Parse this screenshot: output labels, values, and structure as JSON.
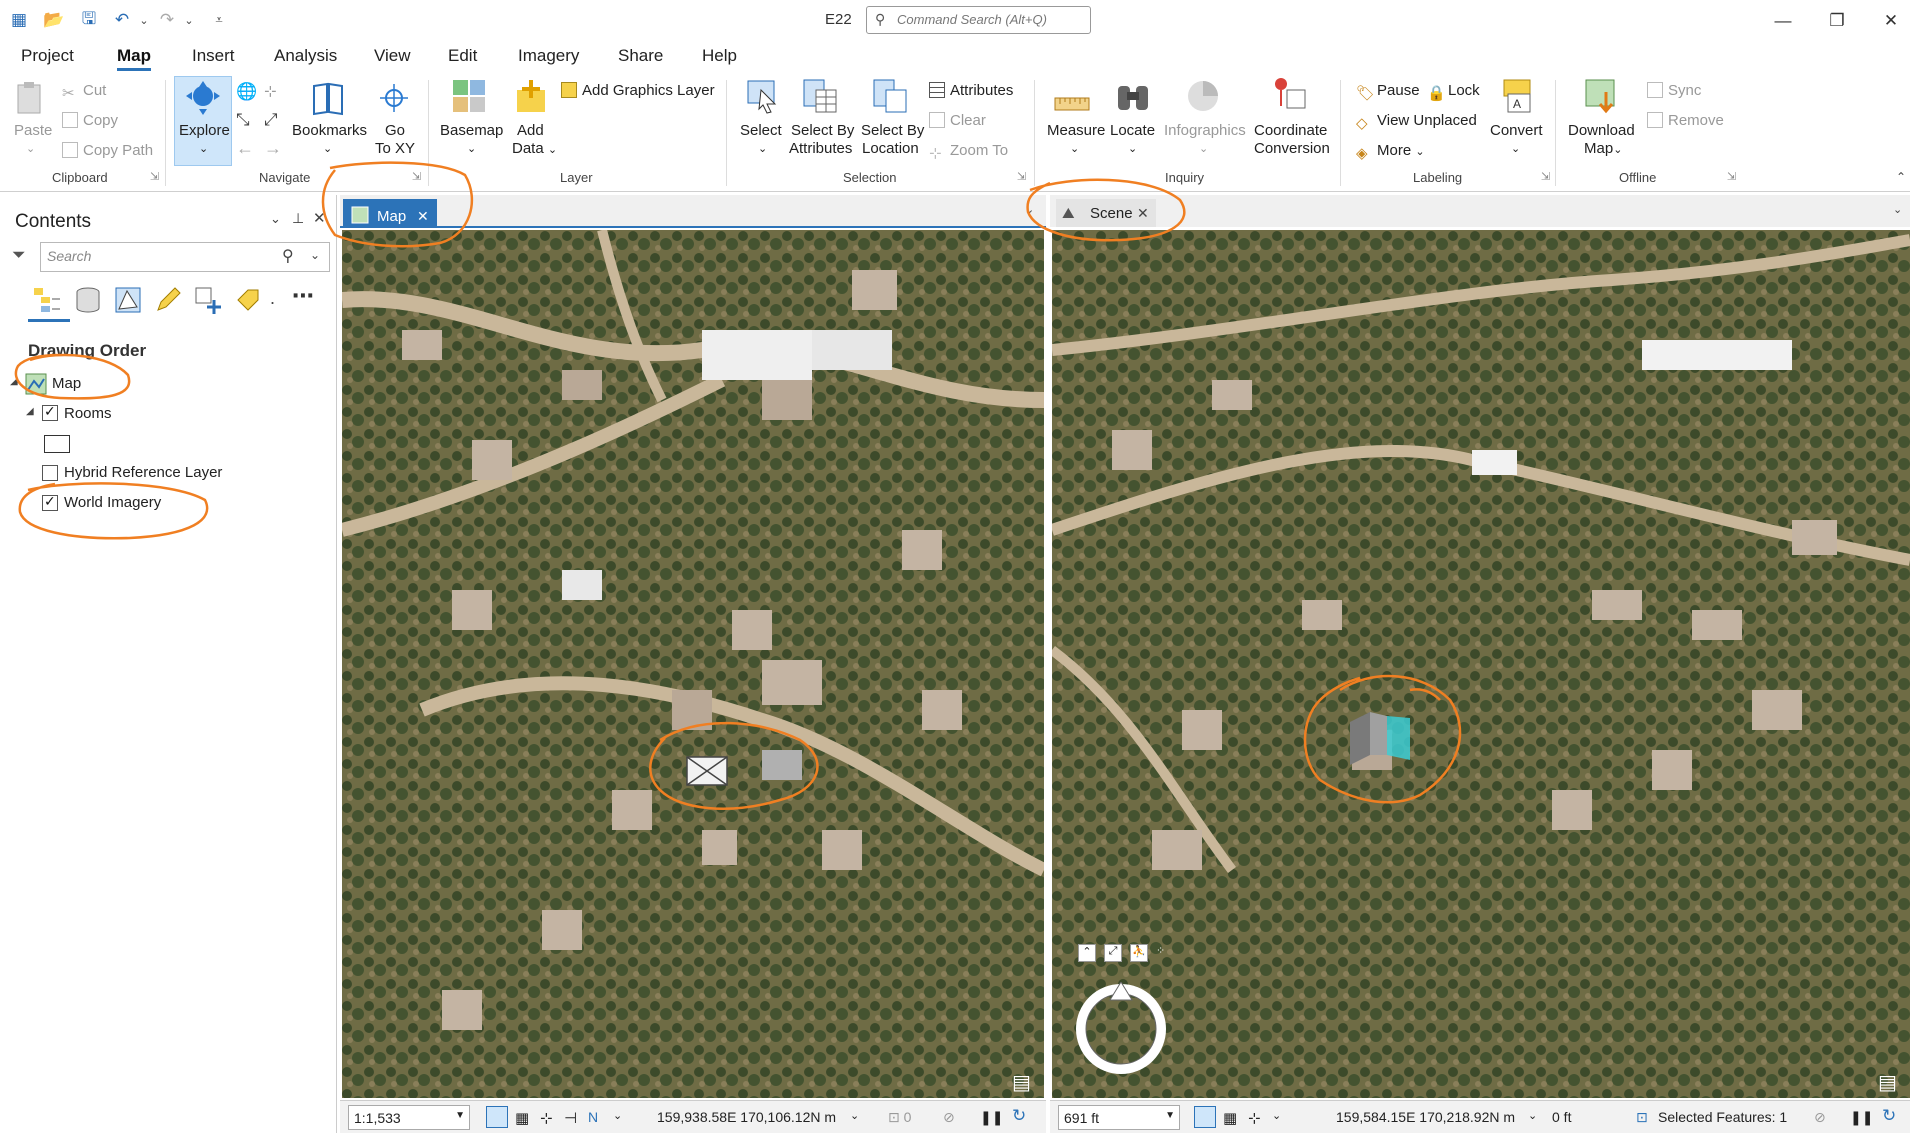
{
  "title_bar": {
    "document_title": "E22",
    "command_search_placeholder": "Command Search (Alt+Q)"
  },
  "menu": [
    "Project",
    "Map",
    "Insert",
    "Analysis",
    "View",
    "Edit",
    "Imagery",
    "Share",
    "Help"
  ],
  "menu_active": "Map",
  "ribbon": {
    "clipboard": {
      "paste": "Paste",
      "cut": "Cut",
      "copy": "Copy",
      "copy_path": "Copy Path",
      "group": "Clipboard"
    },
    "navigate": {
      "explore": "Explore",
      "bookmarks": "Bookmarks",
      "go_to_xy_1": "Go",
      "go_to_xy_2": "To XY",
      "group": "Navigate"
    },
    "layer": {
      "basemap": "Basemap",
      "add_data_1": "Add",
      "add_data_2": "Data",
      "add_graphics_layer": "Add Graphics Layer",
      "group": "Layer"
    },
    "selection": {
      "select": "Select",
      "sba_1": "Select By",
      "sba_2": "Attributes",
      "sbl_1": "Select By",
      "sbl_2": "Location",
      "attributes": "Attributes",
      "clear": "Clear",
      "zoom_to": "Zoom To",
      "group": "Selection"
    },
    "inquiry": {
      "measure": "Measure",
      "locate": "Locate",
      "infographics": "Infographics",
      "coord_1": "Coordinate",
      "coord_2": "Conversion",
      "group": "Inquiry"
    },
    "labeling": {
      "pause": "Pause",
      "lock": "Lock",
      "view_unplaced": "View Unplaced",
      "more": "More",
      "convert": "Convert",
      "group": "Labeling"
    },
    "offline": {
      "download_1": "Download",
      "download_2": "Map",
      "sync": "Sync",
      "remove": "Remove",
      "group": "Offline"
    }
  },
  "contents": {
    "title": "Contents",
    "search_placeholder": "Search",
    "drawing_order": "Drawing Order",
    "layers": [
      {
        "name": "Map",
        "checked": null
      },
      {
        "name": "Rooms",
        "checked": true
      },
      {
        "name": "Hybrid Reference Layer",
        "checked": false
      },
      {
        "name": "World Imagery",
        "checked": true
      }
    ]
  },
  "views": {
    "map": {
      "tab": "Map",
      "scale": "1:1,533",
      "coords": "159,938.58E 170,106.12N m",
      "selected_count": "0"
    },
    "scene": {
      "tab": "Scene",
      "scale": "691 ft",
      "coords": "159,584.15E 170,218.92N m",
      "elevation": "0 ft",
      "selected_features": "Selected Features: 1"
    }
  },
  "colors": {
    "accent": "#2c73b8",
    "annotation": "#f07f22",
    "selection": "#3ccdd4"
  }
}
